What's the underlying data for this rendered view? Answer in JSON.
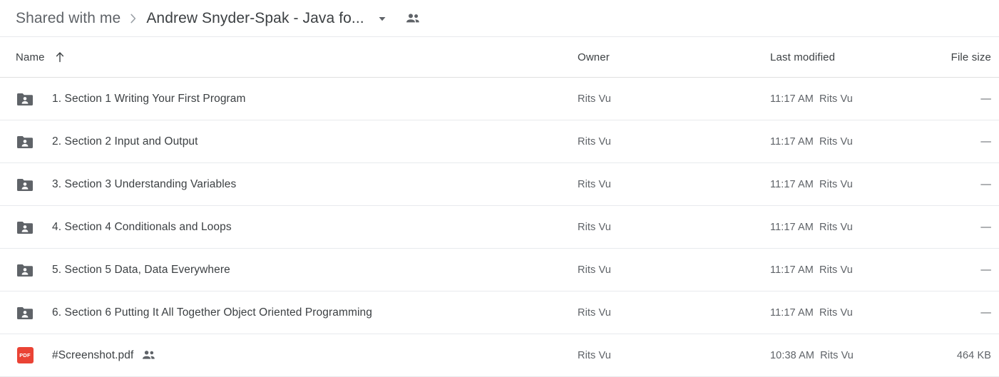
{
  "breadcrumb": {
    "parent": "Shared with me",
    "separator": "›",
    "current": "Andrew Snyder-Spak - Java fo...",
    "caret_icon": "chevron-down-icon",
    "people_icon": "people-icon"
  },
  "columns": {
    "name": "Name",
    "owner": "Owner",
    "last_modified": "Last modified",
    "file_size": "File size",
    "sort_icon": "arrow-up-icon"
  },
  "rows": [
    {
      "icon": "shared-folder-icon",
      "name": "1. Section 1 Writing Your First Program",
      "owner": "Rits Vu",
      "modified_time": "11:17 AM",
      "modified_by": "Rits Vu",
      "size": "—",
      "shared": false
    },
    {
      "icon": "shared-folder-icon",
      "name": "2. Section 2 Input and Output",
      "owner": "Rits Vu",
      "modified_time": "11:17 AM",
      "modified_by": "Rits Vu",
      "size": "—",
      "shared": false
    },
    {
      "icon": "shared-folder-icon",
      "name": "3. Section 3 Understanding Variables",
      "owner": "Rits Vu",
      "modified_time": "11:17 AM",
      "modified_by": "Rits Vu",
      "size": "—",
      "shared": false
    },
    {
      "icon": "shared-folder-icon",
      "name": "4. Section 4 Conditionals and Loops",
      "owner": "Rits Vu",
      "modified_time": "11:17 AM",
      "modified_by": "Rits Vu",
      "size": "—",
      "shared": false
    },
    {
      "icon": "shared-folder-icon",
      "name": "5. Section 5 Data, Data Everywhere",
      "owner": "Rits Vu",
      "modified_time": "11:17 AM",
      "modified_by": "Rits Vu",
      "size": "—",
      "shared": false
    },
    {
      "icon": "shared-folder-icon",
      "name": "6. Section 6 Putting It All Together Object Oriented Programming",
      "owner": "Rits Vu",
      "modified_time": "11:17 AM",
      "modified_by": "Rits Vu",
      "size": "—",
      "shared": false
    },
    {
      "icon": "pdf-file-icon",
      "icon_label": "PDF",
      "name": "#Screenshot.pdf",
      "owner": "Rits Vu",
      "modified_time": "10:38 AM",
      "modified_by": "Rits Vu",
      "size": "464 KB",
      "shared": true
    }
  ],
  "colors": {
    "folder": "#5f6368",
    "pdf": "#ea4335",
    "text_primary": "#3c4043",
    "text_secondary": "#5f6368",
    "divider": "#e8eaed"
  }
}
